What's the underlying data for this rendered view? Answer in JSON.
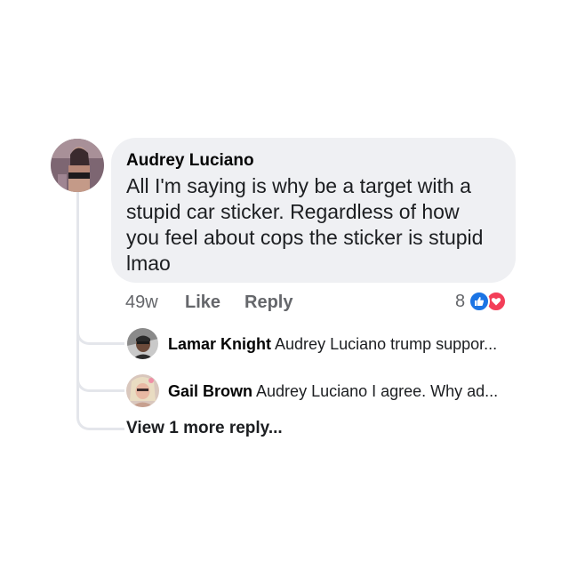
{
  "comment": {
    "author": "Audrey Luciano",
    "text": "All I'm saying is why be a target with a stupid car sticker. Regardless of how you feel about cops the sticker is stupid lmao",
    "time": "49w",
    "like_label": "Like",
    "reply_label": "Reply",
    "reaction_count": "8",
    "reactions": [
      "like-icon",
      "love-icon"
    ]
  },
  "replies": [
    {
      "name": "Lamar Knight",
      "preview": "Audrey Luciano trump suppor..."
    },
    {
      "name": "Gail Brown",
      "preview": "Audrey Luciano I agree. Why ad..."
    }
  ],
  "view_more_label": "View 1 more reply...",
  "colors": {
    "bubble_bg": "#eff0f3",
    "meta_text": "#65676b",
    "like_blue": "#1b74e4",
    "love_red": "#f33e58",
    "thread_line": "#e4e6eb"
  }
}
